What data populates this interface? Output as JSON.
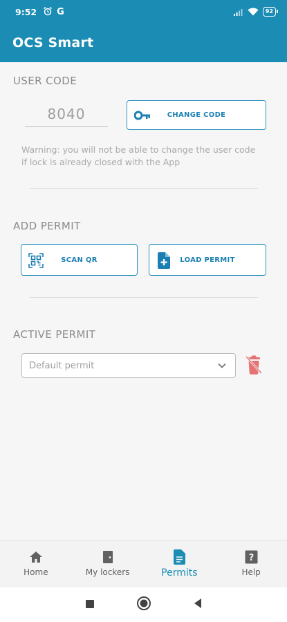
{
  "status_bar": {
    "time": "9:52",
    "google_letter": "G",
    "battery": "92",
    "icons": [
      "alarm-icon",
      "signal-icon",
      "wifi-icon",
      "battery-icon"
    ]
  },
  "app_bar": {
    "title": "OCS Smart",
    "color": "#1b8cb4"
  },
  "user_code": {
    "section_title": "USER CODE",
    "code_value": "8040",
    "change_button": "CHANGE CODE",
    "warning": "Warning: you will not be able to change the user code if lock is already closed with the App"
  },
  "add_permit": {
    "section_title": "ADD PERMIT",
    "scan_button": "SCAN QR",
    "load_button": "LOAD PERMIT"
  },
  "active_permit": {
    "section_title": "ACTIVE PERMIT",
    "selected": "Default permit",
    "delete_icon": "delete-permit-icon",
    "delete_color": "#e57373"
  },
  "bottom_nav": {
    "items": [
      {
        "label": "Home",
        "icon": "home-icon"
      },
      {
        "label": "My lockers",
        "icon": "door-icon"
      },
      {
        "label": "Permits",
        "icon": "document-icon",
        "active": true
      },
      {
        "label": "Help",
        "icon": "help-icon"
      }
    ]
  },
  "system_nav": {
    "buttons": [
      "recents-button",
      "home-button",
      "back-button"
    ]
  }
}
